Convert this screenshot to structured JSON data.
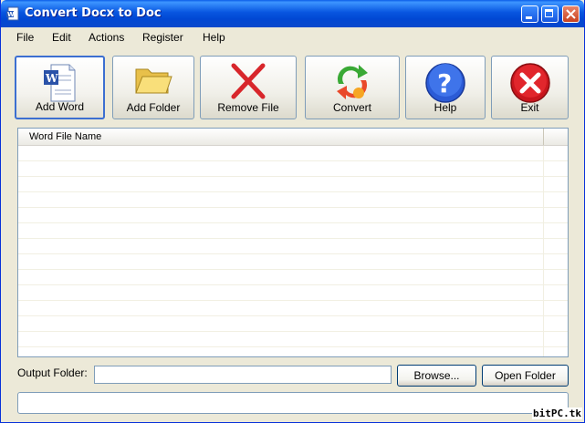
{
  "window": {
    "title": "Convert Docx to Doc"
  },
  "menu": [
    "File",
    "Edit",
    "Actions",
    "Register",
    "Help"
  ],
  "toolbar": {
    "add_word": "Add Word",
    "add_folder": "Add Folder",
    "remove_file": "Remove File",
    "convert": "Convert",
    "help": "Help",
    "exit": "Exit"
  },
  "icons": {
    "add_word": "word-document-icon",
    "add_folder": "folder-icon",
    "remove_file": "red-x-icon",
    "convert": "convert-arrows-icon",
    "help": "question-mark-icon",
    "exit": "exit-x-icon"
  },
  "file_list": {
    "column_header": "Word File Name",
    "rows": []
  },
  "output": {
    "label": "Output Folder:",
    "value": "",
    "browse_label": "Browse...",
    "open_label": "Open Folder"
  },
  "watermark": "bitPC.tk"
}
